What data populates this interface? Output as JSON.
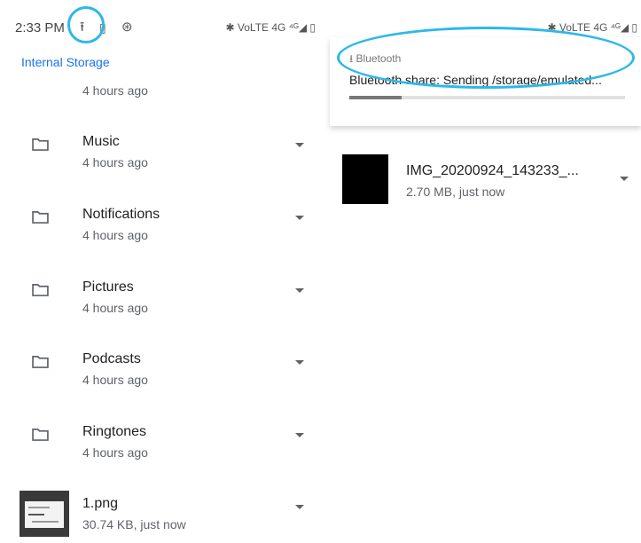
{
  "left": {
    "status": {
      "time": "2:33 PM",
      "upload_icon": "upload-icon",
      "sim_icon": "sim-icon",
      "alarm_icon": "alarm-icon",
      "right": "✱ VoLTE 4G ⁴ᴳ◢ ▯"
    },
    "breadcrumb": "Internal Storage",
    "partial_meta": "4 hours ago",
    "folders": [
      {
        "name": "Music",
        "meta": "4 hours ago"
      },
      {
        "name": "Notifications",
        "meta": "4 hours ago"
      },
      {
        "name": "Pictures",
        "meta": "4 hours ago"
      },
      {
        "name": "Podcasts",
        "meta": "4 hours ago"
      },
      {
        "name": "Ringtones",
        "meta": "4 hours ago"
      }
    ],
    "file": {
      "name": "1.png",
      "meta": "30.74 KB, just now"
    }
  },
  "right": {
    "status": {
      "right": "✱ VoLTE 4G ⁴ᴳ◢ ▯"
    },
    "notification": {
      "app": "Bluetooth",
      "title": "Bluetooth share: Sending /storage/emulated...",
      "progress": 0.19
    },
    "file": {
      "name": "IMG_20200924_143233_...",
      "meta": "2.70 MB, just now"
    }
  },
  "colors": {
    "accent": "#1a73e8",
    "highlight": "#2db8e8"
  }
}
